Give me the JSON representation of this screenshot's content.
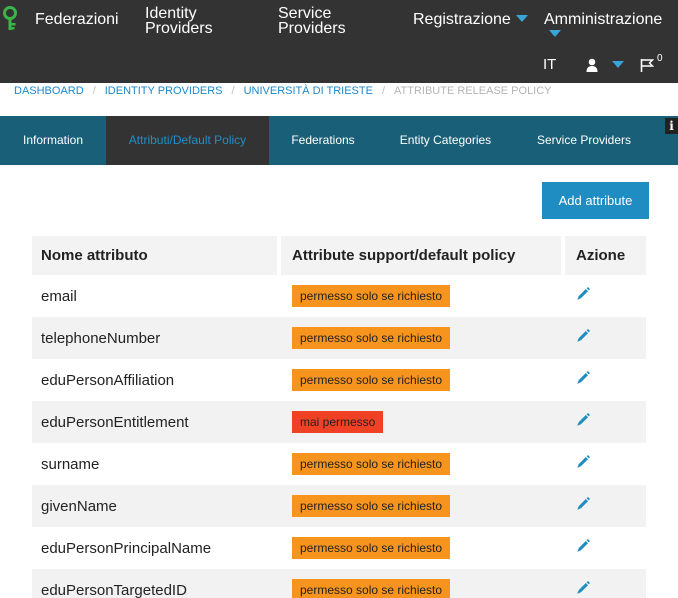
{
  "nav": {
    "federazioni": "Federazioni",
    "identity_providers": [
      "Identity",
      "Providers"
    ],
    "service_providers": [
      "Service",
      "Providers"
    ],
    "registrazione": "Registrazione",
    "amministrazione": "Amministrazione",
    "language": "IT",
    "notifications": "0"
  },
  "breadcrumb": [
    "DASHBOARD",
    "IDENTITY PROVIDERS",
    "UNIVERSITÀ DI TRIESTE",
    "ATTRIBUTE RELEASE POLICY"
  ],
  "tabs": [
    "Information",
    "Attributi/Default Policy",
    "Federations",
    "Entity Categories",
    "Service Providers"
  ],
  "info_badge": "i",
  "add_button": "Add attribute",
  "table": {
    "headers": [
      "Nome attributo",
      "Attribute support/default policy",
      "Azione"
    ],
    "rows": [
      {
        "name": "email",
        "policy": "permesso solo se richiesto",
        "status": "warning"
      },
      {
        "name": "telephoneNumber",
        "policy": "permesso solo se richiesto",
        "status": "warning"
      },
      {
        "name": "eduPersonAffiliation",
        "policy": "permesso solo se richiesto",
        "status": "warning"
      },
      {
        "name": "eduPersonEntitlement",
        "policy": "mai permesso",
        "status": "danger"
      },
      {
        "name": "surname",
        "policy": "permesso solo se richiesto",
        "status": "warning"
      },
      {
        "name": "givenName",
        "policy": "permesso solo se richiesto",
        "status": "warning"
      },
      {
        "name": "eduPersonPrincipalName",
        "policy": "permesso solo se richiesto",
        "status": "warning"
      },
      {
        "name": "eduPersonTargetedID",
        "policy": "permesso solo se richiesto",
        "status": "warning"
      }
    ]
  },
  "colors": {
    "topbar": "#333333",
    "tabbar": "#1a5f78",
    "accent": "#1f8dc1",
    "warning": "#f7941d",
    "danger": "#f04124"
  },
  "icons": {
    "logo": "key-logo-icon",
    "user": "user-icon",
    "notifications": "flag-icon",
    "edit": "pencil-icon"
  }
}
